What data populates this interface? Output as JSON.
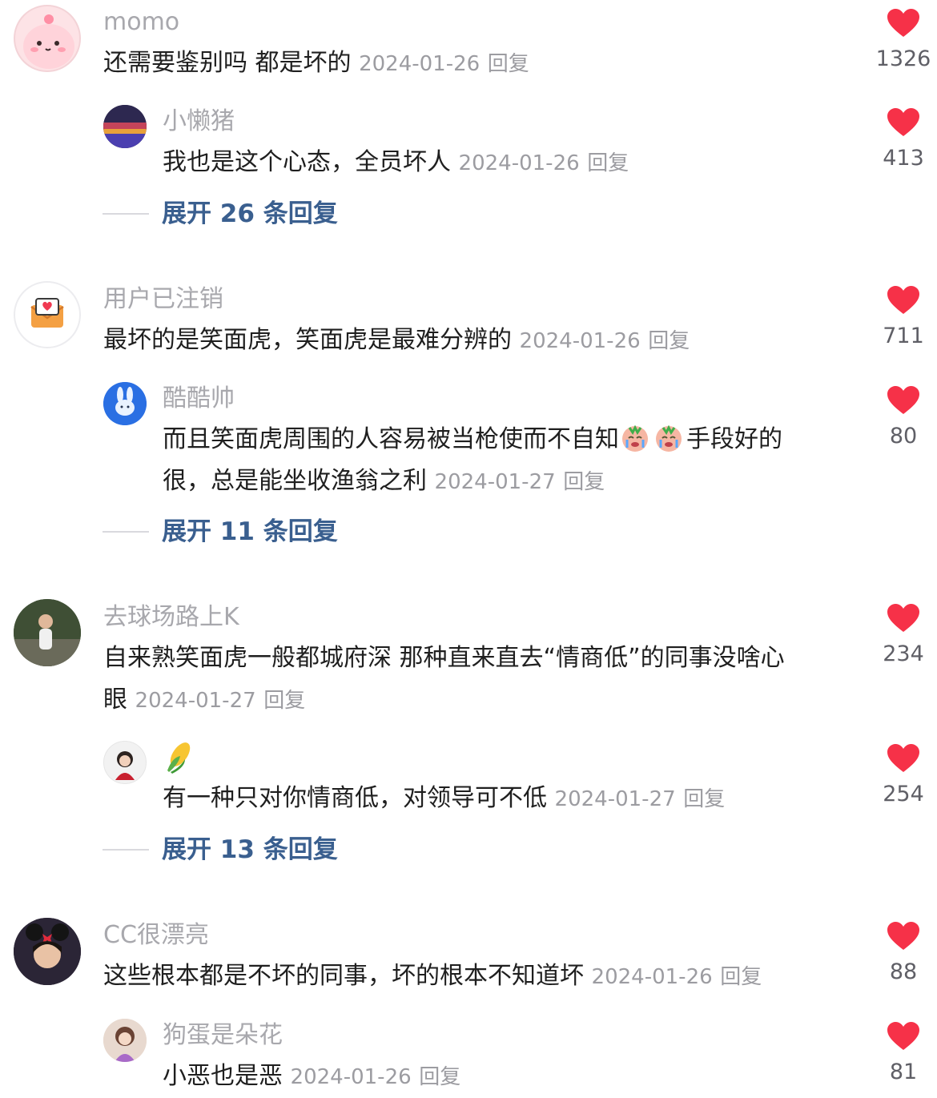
{
  "colors": {
    "heart": "#f63148",
    "username": "#a8a8ad",
    "meta": "#9c9ca1",
    "expand_link": "#3a5f8f"
  },
  "comments": [
    {
      "user": "momo",
      "text": "还需要鉴别吗 都是坏的",
      "date": "2024-01-26",
      "reply_label": "回复",
      "likes": "1326",
      "reply": {
        "user": "小懒猪",
        "text": "我也是这个心态，全员坏人",
        "date": "2024-01-26",
        "reply_label": "回复",
        "likes": "413"
      },
      "expand_label": "展开 26 条回复"
    },
    {
      "user": "用户已注销",
      "text": "最坏的是笑面虎，笑面虎是最难分辨的",
      "date": "2024-01-26",
      "reply_label": "回复",
      "likes": "711",
      "reply": {
        "user": "酷酷帅",
        "text_line1": "而且笑面虎周围的人容易被当枪使而不自知",
        "text_line1_end": "手段好的",
        "text_line2": "很，总是能坐收渔翁之利",
        "emoji_icons": [
          "crying-face-icon",
          "crying-face-icon"
        ],
        "date": "2024-01-27",
        "reply_label": "回复",
        "likes": "80"
      },
      "expand_label": "展开 11 条回复"
    },
    {
      "user": "去球场路上K",
      "text_line1": "自来熟笑面虎一般都城府深 那种直来直去“情商低”的同事没啥心",
      "text_line2": "眼",
      "date": "2024-01-27",
      "reply_label": "回复",
      "likes": "234",
      "reply": {
        "user_icon": "corn-icon",
        "user": "🌽",
        "text": "有一种只对你情商低，对领导可不低",
        "date": "2024-01-27",
        "reply_label": "回复",
        "likes": "254"
      },
      "expand_label": "展开 13 条回复"
    },
    {
      "user": "CC很漂亮",
      "text": "这些根本都是不坏的同事，坏的根本不知道坏",
      "date": "2024-01-26",
      "reply_label": "回复",
      "likes": "88",
      "reply": {
        "user": "狗蛋是朵花",
        "text": "小恶也是恶",
        "date": "2024-01-26",
        "reply_label": "回复",
        "likes": "81"
      }
    }
  ]
}
